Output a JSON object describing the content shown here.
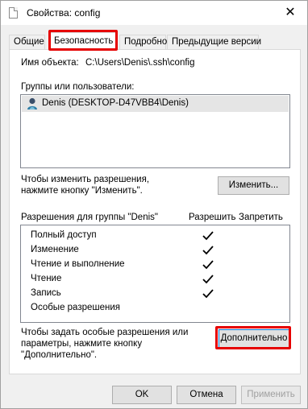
{
  "window": {
    "title": "Свойства: config",
    "close_glyph": "✕"
  },
  "tabs": [
    {
      "label": "Общие",
      "active": false
    },
    {
      "label": "Безопасность",
      "active": true
    },
    {
      "label": "Подробно",
      "active": false
    },
    {
      "label": "Предыдущие версии",
      "active": false
    }
  ],
  "object": {
    "label": "Имя объекта:",
    "value": "C:\\Users\\Denis\\.ssh\\config"
  },
  "groups": {
    "label": "Группы или пользователи:",
    "items": [
      {
        "name": "Denis (DESKTOP-D47VBB4\\Denis)",
        "icon": "user-icon",
        "selected": true
      }
    ]
  },
  "change": {
    "hint_line1": "Чтобы изменить разрешения,",
    "hint_line2": "нажмите кнопку \"Изменить\".",
    "button_label": "Изменить..."
  },
  "permissions": {
    "header_label": "Разрешения для группы \"Denis\"",
    "allow_label": "Разрешить",
    "deny_label": "Запретить",
    "rows": [
      {
        "name": "Полный доступ",
        "allow": true,
        "deny": false
      },
      {
        "name": "Изменение",
        "allow": true,
        "deny": false
      },
      {
        "name": "Чтение и выполнение",
        "allow": true,
        "deny": false
      },
      {
        "name": "Чтение",
        "allow": true,
        "deny": false
      },
      {
        "name": "Запись",
        "allow": true,
        "deny": false
      },
      {
        "name": "Особые разрешения",
        "allow": false,
        "deny": false
      }
    ]
  },
  "advanced": {
    "hint_line1": "Чтобы задать особые разрешения или",
    "hint_line2": "параметры, нажмите кнопку",
    "hint_line3": "\"Дополнительно\".",
    "button_label": "Дополнительно"
  },
  "footer": {
    "ok_label": "OK",
    "cancel_label": "Отмена",
    "apply_label": "Применить"
  },
  "colors": {
    "highlight_red": "#e60000",
    "focus_blue": "#0078d7",
    "selection_gray": "#e5e5e5"
  }
}
